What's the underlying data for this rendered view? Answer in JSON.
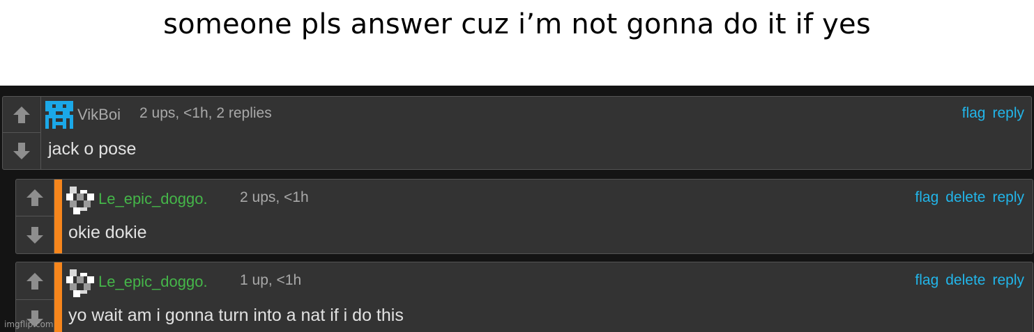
{
  "caption": "someone pls answer cuz i’m not gonna do it if yes",
  "comments": [
    {
      "username": "VikBoi",
      "meta": "2 ups, <1h, 2 replies",
      "actions": [
        "flag",
        "reply"
      ],
      "text": "jack o pose",
      "avatar": "blue-pixel-avatar-icon"
    },
    {
      "username": "Le_epic_doggo.",
      "meta": "2 ups, <1h",
      "actions": [
        "flag",
        "delete",
        "reply"
      ],
      "text": "okie dokie",
      "avatar": "gray-pixel-avatar-icon"
    },
    {
      "username": "Le_epic_doggo.",
      "meta": "1 up, <1h",
      "actions": [
        "flag",
        "delete",
        "reply"
      ],
      "text": "yo wait am i gonna turn into a nat if i do this",
      "avatar": "gray-pixel-avatar-icon"
    }
  ],
  "watermark": "imgflip.com",
  "colors": {
    "panel": "#333333",
    "link": "#22b6ea",
    "reply_bar": "#f7861c",
    "username_green": "#45b649"
  }
}
